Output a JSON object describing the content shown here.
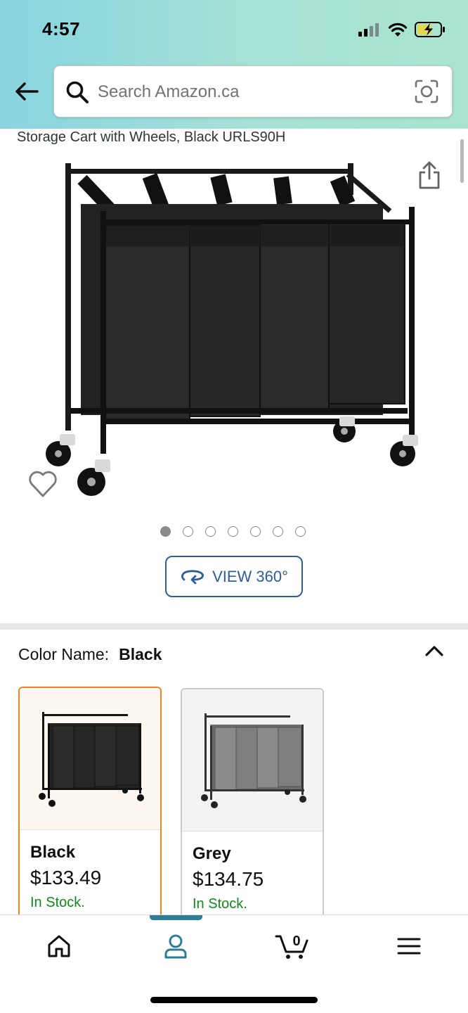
{
  "status_bar": {
    "time": "4:57"
  },
  "search": {
    "placeholder": "Search Amazon.ca",
    "value": ""
  },
  "product": {
    "title_fragment": "Storage Cart with Wheels, Black URLS90H"
  },
  "gallery": {
    "image_count": 7,
    "active_index": 0,
    "view360_label": "VIEW 360°"
  },
  "variations": {
    "color_label": "Color Name:",
    "selected_color": "Black",
    "options": [
      {
        "name": "Black",
        "price": "$133.49",
        "stock": "In Stock.",
        "selected": true
      },
      {
        "name": "Grey",
        "price": "$134.75",
        "stock": "In Stock.",
        "selected": false
      }
    ]
  },
  "bottom_nav": {
    "items": [
      "home-icon",
      "account-icon",
      "cart-icon",
      "menu-icon"
    ],
    "active": "account-icon",
    "cart_count": "0"
  },
  "colors": {
    "accent_blue": "#2b5d9d",
    "selected_border": "#e3872b",
    "in_stock_green": "#108a1e",
    "nav_active": "#2d7e94"
  }
}
